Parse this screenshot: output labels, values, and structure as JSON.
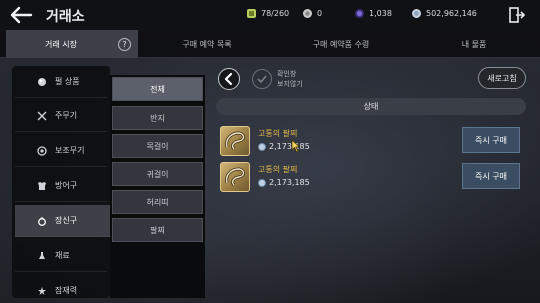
{
  "header": {
    "title": "거래소",
    "resources": [
      {
        "icon": "energy-icon",
        "value": "78/260",
        "color": "#b7cf5c"
      },
      {
        "icon": "silver-coin-icon",
        "value": "0",
        "color": "#c9c9c9"
      },
      {
        "icon": "crystal-icon",
        "value": "1,038",
        "color": "#7b6ad6"
      },
      {
        "icon": "silver-icon",
        "value": "502,962,146",
        "color": "#c7d4e2"
      }
    ]
  },
  "tabs": [
    {
      "label": "거래 시장",
      "active": true
    },
    {
      "label": "구매 예약 목록"
    },
    {
      "label": "구매 예약품 수령"
    },
    {
      "label": "내 물품"
    }
  ],
  "help_label": "?",
  "categories": [
    {
      "label": "펄 상품",
      "icon": "pearl-icon"
    },
    {
      "label": "주무기",
      "icon": "crossed-swords-icon"
    },
    {
      "label": "보조무기",
      "icon": "sub-weapon-icon"
    },
    {
      "label": "방어구",
      "icon": "armor-icon"
    },
    {
      "label": "장신구",
      "icon": "ring-icon",
      "active": true
    },
    {
      "label": "재료",
      "icon": "material-icon"
    },
    {
      "label": "잠재력",
      "icon": "potential-icon"
    }
  ],
  "subcategories": [
    {
      "label": "전체",
      "active": true
    },
    {
      "label": "반지"
    },
    {
      "label": "목걸이"
    },
    {
      "label": "귀걸이"
    },
    {
      "label": "허리띠"
    },
    {
      "label": "팔찌"
    }
  ],
  "filter": {
    "label_line1": "확인창",
    "label_line2": "보지않기"
  },
  "refresh_label": "새로고침",
  "status_header": "상태",
  "listings": [
    {
      "name": "고통의 팔찌",
      "price": "2,173,185",
      "buy_label": "즉시 구매"
    },
    {
      "name": "고통의 팔찌",
      "price": "2,173,185",
      "buy_label": "즉시 구매"
    }
  ]
}
